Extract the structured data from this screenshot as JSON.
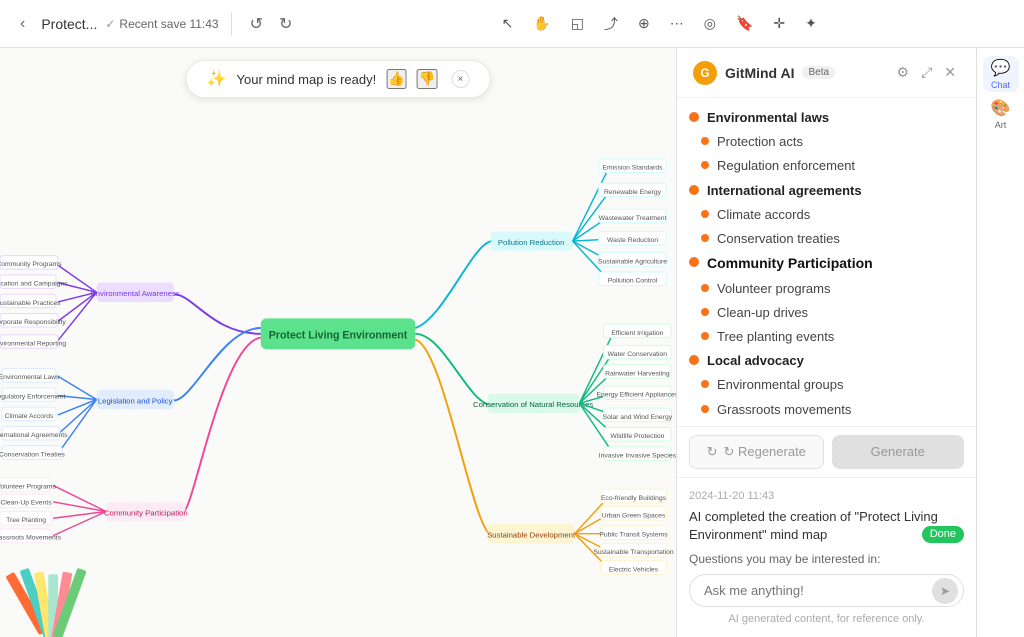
{
  "toolbar": {
    "back_icon": "‹",
    "title": "Protect...",
    "save_status": "Recent save 11:43",
    "undo_icon": "↺",
    "redo_icon": "↻",
    "tools": [
      {
        "name": "cursor-tool",
        "icon": "↖",
        "label": "cursor"
      },
      {
        "name": "hand-tool",
        "icon": "✋",
        "label": "hand"
      },
      {
        "name": "shape-tool",
        "icon": "◱",
        "label": "shape"
      },
      {
        "name": "connector-tool",
        "icon": "⤴",
        "label": "connector"
      },
      {
        "name": "add-node-tool",
        "icon": "⊕",
        "label": "add"
      },
      {
        "name": "branch-tool",
        "icon": "⋮",
        "label": "branch"
      },
      {
        "name": "style-tool",
        "icon": "◎",
        "label": "style"
      },
      {
        "name": "bookmark-tool",
        "icon": "🔖",
        "label": "bookmark"
      },
      {
        "name": "plus-tool",
        "icon": "✛",
        "label": "plus"
      },
      {
        "name": "magic-tool",
        "icon": "✦",
        "label": "magic"
      }
    ]
  },
  "notification": {
    "text": "Your mind map is ready!",
    "sparkle": "✨",
    "thumbs_up": "👍",
    "thumbs_down": "👎",
    "close": "×"
  },
  "mindmap": {
    "center_label": "Protect Living Environment"
  },
  "sidebar": {
    "logo_text": "G",
    "title": "GitMind AI",
    "beta_label": "Beta",
    "topics": [
      {
        "level": 1,
        "text": "Environmental laws",
        "color": "#f97316"
      },
      {
        "level": 2,
        "text": "Protection acts",
        "color": "#f97316"
      },
      {
        "level": 2,
        "text": "Regulation enforcement",
        "color": "#f97316"
      },
      {
        "level": 1,
        "text": "International agreements",
        "color": "#f97316"
      },
      {
        "level": 2,
        "text": "Climate accords",
        "color": "#f97316"
      },
      {
        "level": 2,
        "text": "Conservation treaties",
        "color": "#f97316"
      },
      {
        "level": 1,
        "text": "Community Participation",
        "color": "#f97316",
        "highlight": true
      },
      {
        "level": 2,
        "text": "Volunteer programs",
        "color": "#f97316"
      },
      {
        "level": 2,
        "text": "Clean-up drives",
        "color": "#f97316"
      },
      {
        "level": 2,
        "text": "Tree planting events",
        "color": "#f97316"
      },
      {
        "level": 1,
        "text": "Local advocacy",
        "color": "#f97316"
      },
      {
        "level": 2,
        "text": "Environmental groups",
        "color": "#f97316"
      },
      {
        "level": 2,
        "text": "Grassroots movements",
        "color": "#f97316"
      }
    ],
    "regenerate_label": "↻  Regenerate",
    "generate_label": "Generate"
  },
  "panel_icons": [
    {
      "name": "chat-icon",
      "symbol": "💬",
      "label": "Chat",
      "active": true
    },
    {
      "name": "art-icon",
      "symbol": "🎨",
      "label": "Art",
      "active": false
    }
  ],
  "chat": {
    "timestamp": "2024-11-20 11:43",
    "message": "AI completed the creation of \"Protect Living Environment\" mind map",
    "done_label": "Done",
    "questions_prompt": "Questions you may be interested in:",
    "input_placeholder": "Ask me anything!",
    "disclaimer": "AI generated content, for reference only.",
    "send_icon": "➤"
  }
}
